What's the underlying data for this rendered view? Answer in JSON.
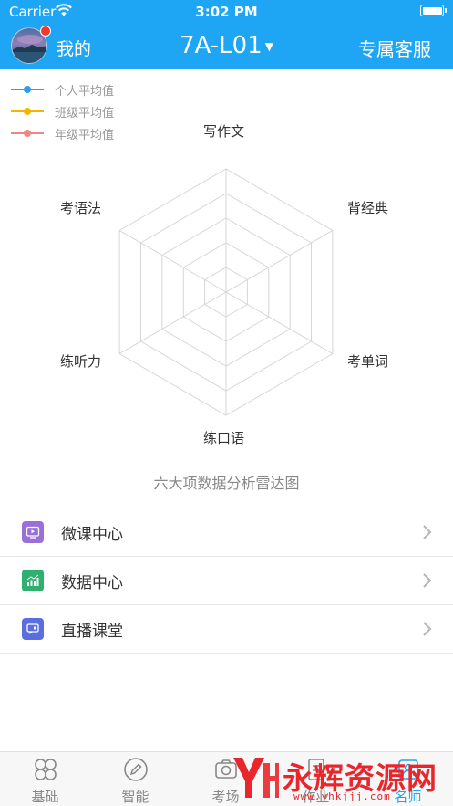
{
  "status_bar": {
    "carrier": "Carrier",
    "time": "3:02 PM"
  },
  "nav": {
    "my_label": "我的",
    "class_title": "7A-L01",
    "service_label": "专属客服"
  },
  "legend": [
    {
      "label": "个人平均值",
      "color": "#2d9cf0"
    },
    {
      "label": "班级平均值",
      "color": "#f5b400"
    },
    {
      "label": "年级平均值",
      "color": "#f08585"
    }
  ],
  "chart_data": {
    "type": "radar",
    "axes": [
      "写作文",
      "背经典",
      "考单词",
      "练口语",
      "练听力",
      "考语法"
    ],
    "levels": 5,
    "series": [
      {
        "name": "个人平均值",
        "values": [
          0,
          0,
          0,
          0,
          0,
          0
        ]
      },
      {
        "name": "班级平均值",
        "values": [
          0,
          0,
          0,
          0,
          0,
          0
        ]
      },
      {
        "name": "年级平均值",
        "values": [
          0,
          0,
          0,
          0,
          0,
          0
        ]
      }
    ],
    "caption": "六大项数据分析雷达图",
    "grid_color": "#d6d6d6"
  },
  "menu": [
    {
      "label": "微课中心",
      "icon": "play-video-icon",
      "color": "#9b6fd8"
    },
    {
      "label": "数据中心",
      "icon": "bar-chart-icon",
      "color": "#2fb06f"
    },
    {
      "label": "直播课堂",
      "icon": "live-chat-icon",
      "color": "#5a6ee0"
    }
  ],
  "tabs": [
    {
      "label": "基础",
      "icon": "grid-icon",
      "active": false
    },
    {
      "label": "智能",
      "icon": "pen-circle-icon",
      "active": false
    },
    {
      "label": "考场",
      "icon": "camera-icon",
      "active": false
    },
    {
      "label": "作业",
      "icon": "document-icon",
      "active": false
    },
    {
      "label": "名师",
      "icon": "teacher-icon",
      "active": true
    }
  ],
  "watermark": {
    "text": "永辉资源网",
    "url": "www.yhkjjj.com"
  },
  "accent_color": "#1ea6f5"
}
